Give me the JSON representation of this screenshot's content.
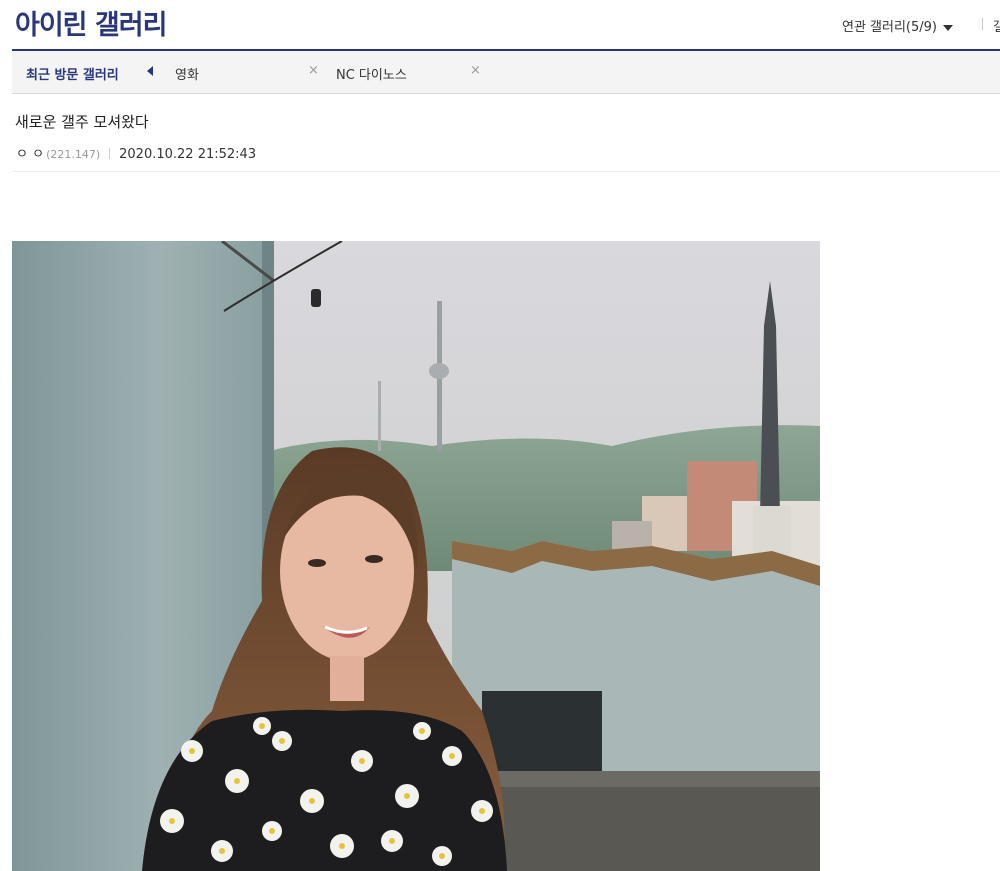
{
  "header": {
    "gallery_title": "아이린 갤러리",
    "related_gallery": "연관 갤러리(5/9)",
    "cut_text": "갤"
  },
  "recent_visits": {
    "label": "최근 방문 갤러리",
    "items": [
      {
        "label": "영화",
        "close": "×"
      },
      {
        "label": "NC 다이노스",
        "close": "×"
      }
    ]
  },
  "post": {
    "title": "새로운 갤주 모셔왔다",
    "author": "ㅇ ㅇ",
    "ip": "(221.147)",
    "date": "2020.10.22 21:52:43"
  },
  "colors": {
    "accent": "#29367c",
    "bar_bg": "#f4f4f4"
  },
  "icons": {
    "related_dropdown": "caret-down-icon",
    "recent_toggle": "caret-left-icon",
    "close": "close-icon"
  }
}
